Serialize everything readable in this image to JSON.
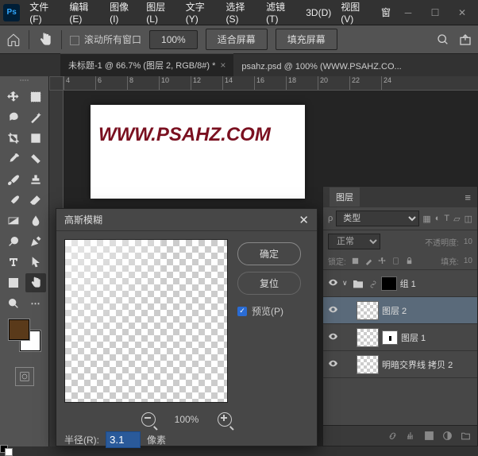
{
  "menu": {
    "file": "文件(F)",
    "edit": "编辑(E)",
    "image": "图像(I)",
    "layer": "图层(L)",
    "text": "文字(Y)",
    "select": "选择(S)",
    "filter": "滤镜(T)",
    "three_d": "3D(D)",
    "view": "视图(V)",
    "window": "窗"
  },
  "optbar": {
    "scroll_all": "滚动所有窗口",
    "zoom": "100%",
    "fit": "适合屏幕",
    "fill": "填充屏幕"
  },
  "tabs": {
    "t1": "未标题-1 @ 66.7% (图层 2, RGB/8#) *",
    "t2": "psahz.psd @ 100% (WWW.PSAHZ.CO..."
  },
  "ruler": {
    "m4": "4",
    "m6": "6",
    "m8": "8",
    "m10": "10",
    "m12": "12",
    "m14": "14",
    "m16": "16",
    "m18": "18",
    "m20": "20",
    "m22": "22",
    "m24": "24"
  },
  "canvas": {
    "text": "WWW.PSAHZ.COM"
  },
  "dialog": {
    "title": "高斯模糊",
    "ok": "确定",
    "reset": "复位",
    "preview": "预览(P)",
    "zoom": "100%",
    "radius_label": "半径(R):",
    "radius_value": "3.1",
    "unit": "像素"
  },
  "layers": {
    "title": "图层",
    "kind": "类型",
    "blend": "正常",
    "opacity_label": "不透明度:",
    "opacity_val": "10",
    "lock_label": "锁定:",
    "fill_label": "填充:",
    "fill_val": "10",
    "group1": "组 1",
    "layer2": "图层 2",
    "layer1": "图层 1",
    "layer_copy": "明暗交界线 拷贝 2"
  }
}
